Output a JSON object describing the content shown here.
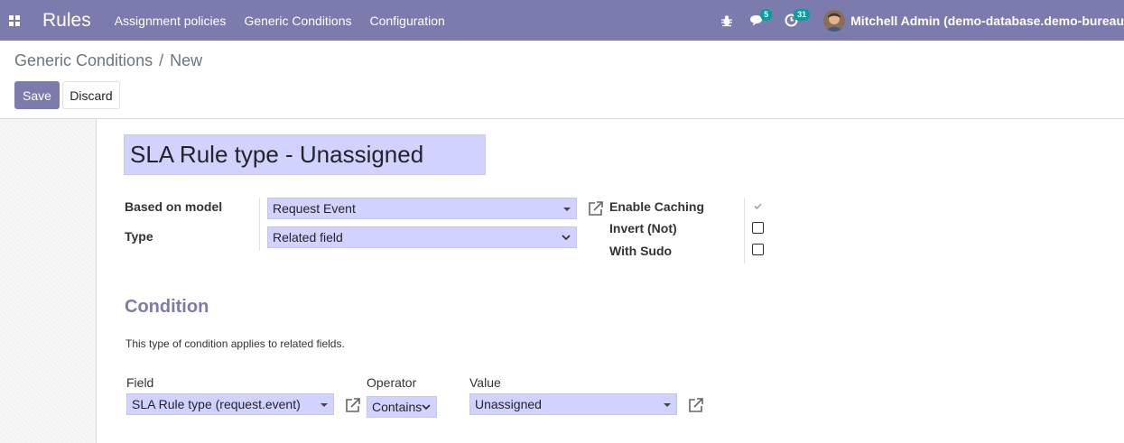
{
  "navbar": {
    "app_title": "Rules",
    "menu": [
      "Assignment policies",
      "Generic Conditions",
      "Configuration"
    ],
    "messages_count": "5",
    "activities_count": "31",
    "user_name": "Mitchell Admin (demo-database.demo-bureau"
  },
  "breadcrumb": {
    "parent": "Generic Conditions",
    "separator": "/",
    "current": "New"
  },
  "buttons": {
    "save": "Save",
    "discard": "Discard"
  },
  "form": {
    "name": "SLA Rule type - Unassigned",
    "based_on_model_label": "Based on model",
    "based_on_model_value": "Request Event",
    "type_label": "Type",
    "type_value": "Related field",
    "enable_caching_label": "Enable Caching",
    "enable_caching_checked": true,
    "invert_label": "Invert (Not)",
    "invert_checked": false,
    "with_sudo_label": "With Sudo",
    "with_sudo_checked": false
  },
  "condition": {
    "section_title": "Condition",
    "help_text": "This type of condition applies to related fields.",
    "field_label": "Field",
    "field_value": "SLA Rule type (request.event)",
    "operator_label": "Operator",
    "operator_value": "Contains",
    "value_label": "Value",
    "value_value": "Unassigned"
  },
  "colors": {
    "brand": "#7c7bad",
    "input_bg": "#d2d2ff",
    "badge": "#00a09d"
  }
}
